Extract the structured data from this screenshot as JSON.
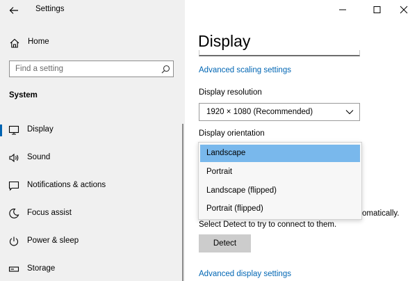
{
  "window": {
    "title": "Settings",
    "icons": {
      "back": "back-arrow-icon",
      "minimize": "minimize-icon",
      "maximize": "maximize-icon",
      "close": "close-icon"
    }
  },
  "sidebar": {
    "home_label": "Home",
    "search_placeholder": "Find a setting",
    "section_title": "System",
    "items": [
      {
        "label": "Display",
        "icon": "monitor-icon",
        "selected": true
      },
      {
        "label": "Sound",
        "icon": "speaker-icon",
        "selected": false
      },
      {
        "label": "Notifications & actions",
        "icon": "notification-icon",
        "selected": false
      },
      {
        "label": "Focus assist",
        "icon": "moon-icon",
        "selected": false
      },
      {
        "label": "Power & sleep",
        "icon": "power-icon",
        "selected": false
      },
      {
        "label": "Storage",
        "icon": "storage-icon",
        "selected": false
      }
    ]
  },
  "main": {
    "page_title": "Display",
    "advanced_scaling_link": "Advanced scaling settings",
    "resolution_label": "Display resolution",
    "resolution_value": "1920 × 1080 (Recommended)",
    "orientation_label": "Display orientation",
    "orientation_options": [
      "Landscape",
      "Portrait",
      "Landscape (flipped)",
      "Portrait (flipped)"
    ],
    "orientation_selected_index": 0,
    "detect_partial_text": "omatically.",
    "detect_instruction": "Select Detect to try to connect to them.",
    "detect_button": "Detect",
    "advanced_display_link": "Advanced display settings"
  },
  "colors": {
    "sidebar_bg": "#f0f0f0",
    "accent": "#0063b1",
    "link": "#0066b4",
    "dropdown_highlight": "#79b8ec",
    "button_bg": "#cccccc"
  }
}
